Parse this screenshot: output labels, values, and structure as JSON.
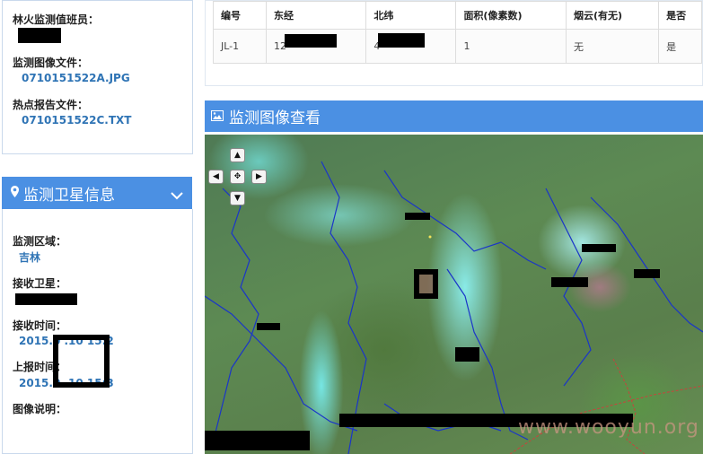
{
  "duty_panel": {
    "duty_staff_label": "林火监测值班员：",
    "image_file_label": "监测图像文件：",
    "image_file_value": "0710151522A.JPG",
    "report_file_label": "热点报告文件：",
    "report_file_value": "0710151522C.TXT"
  },
  "satellite_panel": {
    "title": "监测卫星信息",
    "region_label": "监测区域：",
    "region_value": "吉林",
    "satellite_label": "接收卫星：",
    "receive_time_label": "接收时间：",
    "receive_time_value": "2015.0 .10 15:2",
    "report_time_label": "上报时间：",
    "report_time_value": "2015.0 .10 15:3",
    "description_label": "图像说明："
  },
  "hotspot_table": {
    "headers": [
      "编号",
      "东经",
      "北纬",
      "面积(像素数)",
      "烟云(有无)",
      "是否"
    ],
    "rows": [
      [
        "JL-1",
        "12",
        "4",
        "1",
        "无",
        "是"
      ]
    ]
  },
  "image_viewer": {
    "title": "监测图像查看",
    "watermark": "www.wooyun.org"
  },
  "colors": {
    "header_blue": "#4b90e3",
    "link_blue": "#2f74b5"
  }
}
